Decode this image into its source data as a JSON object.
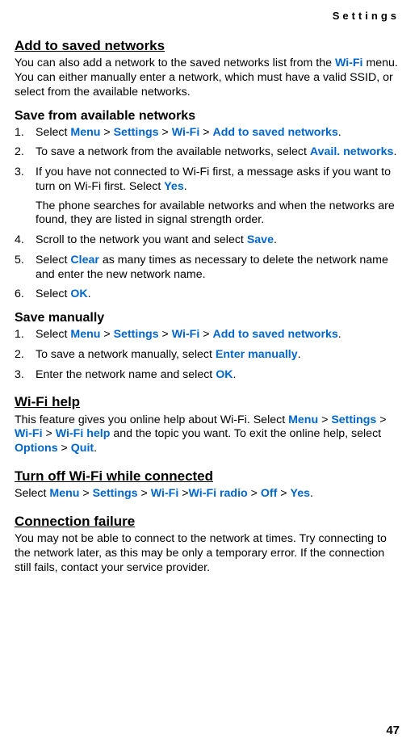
{
  "header": {
    "title": "Settings"
  },
  "page_number": "47",
  "s1": {
    "title": "Add to saved networks",
    "intro_a": "You can also add a network to the saved networks list from the ",
    "intro_b": "Wi-Fi",
    "intro_c": " menu. You can either manually enter a network, which must have a valid SSID, or select from the available networks."
  },
  "s2": {
    "title": "Save from available networks",
    "i1_a": "Select ",
    "i1_menu": "Menu",
    "i1_sep1": " > ",
    "i1_settings": "Settings",
    "i1_sep2": " > ",
    "i1_wifi": "Wi-Fi",
    "i1_sep3": " > ",
    "i1_add": "Add to saved networks",
    "i1_end": ".",
    "i2_a": "To save a network from the available networks, select ",
    "i2_b": "Avail. networks",
    "i2_c": ".",
    "i3_a": "If you have not connected to Wi-Fi first, a message asks if you want to turn on Wi-Fi first. Select ",
    "i3_b": "Yes",
    "i3_c": ".",
    "i3_sub": "The phone searches for available networks and when the networks are found, they are listed in signal strength order.",
    "i4_a": "Scroll to the network you want and select ",
    "i4_b": "Save",
    "i4_c": ".",
    "i5_a": "Select ",
    "i5_b": "Clear",
    "i5_c": " as many times as necessary to delete the network name and enter the new network name.",
    "i6_a": "Select ",
    "i6_b": "OK",
    "i6_c": "."
  },
  "s3": {
    "title": "Save manually",
    "i1_a": "Select ",
    "i1_menu": "Menu",
    "i1_sep1": " > ",
    "i1_settings": "Settings",
    "i1_sep2": " > ",
    "i1_wifi": "Wi-Fi",
    "i1_sep3": " > ",
    "i1_add": "Add to saved networks",
    "i1_end": ".",
    "i2_a": "To save a network manually, select ",
    "i2_b": "Enter manually",
    "i2_c": ".",
    "i3_a": "Enter the network name and select ",
    "i3_b": "OK",
    "i3_c": "."
  },
  "s4": {
    "title": "Wi-Fi help",
    "a": "This feature gives you online help about Wi-Fi. Select ",
    "menu": "Menu",
    "sep1": " > ",
    "settings": "Settings",
    "sep2": " > ",
    "wifi": "Wi-Fi",
    "sep3": " > ",
    "help": "Wi-Fi help",
    "b": " and the topic you want. To exit the online help, select ",
    "options": "Options",
    "sep4": " > ",
    "quit": "Quit",
    "end": "."
  },
  "s5": {
    "title": "Turn off Wi-Fi while connected",
    "a": "Select ",
    "menu": "Menu",
    "sep1": " > ",
    "settings": "Settings",
    "sep2": " > ",
    "wifi": "Wi-Fi",
    "sep3": " >",
    "radio": "Wi-Fi radio",
    "sep4": " > ",
    "off": "Off",
    "sep5": " > ",
    "yes": "Yes",
    "end": "."
  },
  "s6": {
    "title": "Connection failure",
    "body": "You may not be able to connect to the network at times. Try connecting to the network later, as this may be only a temporary error. If the connection still fails, contact your service provider."
  }
}
